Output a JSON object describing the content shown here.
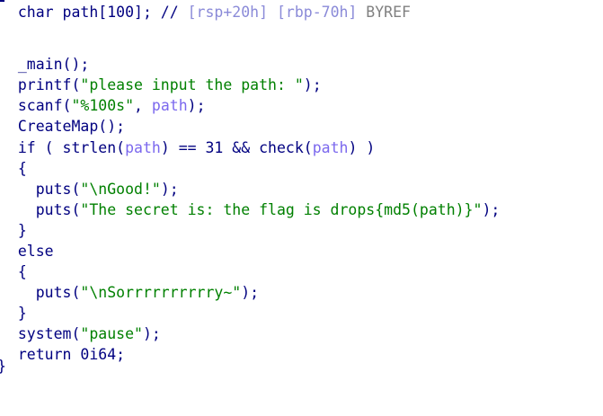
{
  "colors": {
    "default": "#000080",
    "string": "#008000",
    "variable": "#7b68ee",
    "comment": "#808080",
    "ref": "#8a8ad8",
    "background": "#ffffff"
  },
  "code_lines": [
    {
      "kind": "declaration",
      "tokens": [
        {
          "t": "  char path[100]; // ",
          "c": "default"
        },
        {
          "t": "[rsp+20h] [rbp-70h]",
          "c": "ref"
        },
        {
          "t": " BYREF",
          "c": "comment"
        }
      ]
    },
    {
      "kind": "blank",
      "tokens": []
    },
    {
      "kind": "call",
      "tokens": [
        {
          "t": "  _main();",
          "c": "default"
        }
      ]
    },
    {
      "kind": "call",
      "tokens": [
        {
          "t": "  printf(",
          "c": "default"
        },
        {
          "t": "\"please input the path: \"",
          "c": "string"
        },
        {
          "t": ");",
          "c": "default"
        }
      ]
    },
    {
      "kind": "call",
      "tokens": [
        {
          "t": "  scanf(",
          "c": "default"
        },
        {
          "t": "\"%100s\"",
          "c": "string"
        },
        {
          "t": ", ",
          "c": "default"
        },
        {
          "t": "path",
          "c": "variable"
        },
        {
          "t": ");",
          "c": "default"
        }
      ]
    },
    {
      "kind": "call",
      "tokens": [
        {
          "t": "  CreateMap();",
          "c": "default"
        }
      ]
    },
    {
      "kind": "condition",
      "tokens": [
        {
          "t": "  if ( strlen(",
          "c": "default"
        },
        {
          "t": "path",
          "c": "variable"
        },
        {
          "t": ") == 31 && check(",
          "c": "default"
        },
        {
          "t": "path",
          "c": "variable"
        },
        {
          "t": ") )",
          "c": "default"
        }
      ]
    },
    {
      "kind": "brace",
      "tokens": [
        {
          "t": "  {",
          "c": "default"
        }
      ]
    },
    {
      "kind": "call",
      "tokens": [
        {
          "t": "    puts(",
          "c": "default"
        },
        {
          "t": "\"\\nGood!\"",
          "c": "string"
        },
        {
          "t": ");",
          "c": "default"
        }
      ]
    },
    {
      "kind": "call",
      "tokens": [
        {
          "t": "    puts(",
          "c": "default"
        },
        {
          "t": "\"The secret is: the flag is drops{md5(path)}\"",
          "c": "string"
        },
        {
          "t": ");",
          "c": "default"
        }
      ]
    },
    {
      "kind": "brace",
      "tokens": [
        {
          "t": "  }",
          "c": "default"
        }
      ]
    },
    {
      "kind": "keyword",
      "tokens": [
        {
          "t": "  else",
          "c": "default"
        }
      ]
    },
    {
      "kind": "brace",
      "tokens": [
        {
          "t": "  {",
          "c": "default"
        }
      ]
    },
    {
      "kind": "call",
      "tokens": [
        {
          "t": "    puts(",
          "c": "default"
        },
        {
          "t": "\"\\nSorrrrrrrrrry~\"",
          "c": "string"
        },
        {
          "t": ");",
          "c": "default"
        }
      ]
    },
    {
      "kind": "brace",
      "tokens": [
        {
          "t": "  }",
          "c": "default"
        }
      ]
    },
    {
      "kind": "call",
      "tokens": [
        {
          "t": "  system(",
          "c": "default"
        },
        {
          "t": "\"pause\"",
          "c": "string"
        },
        {
          "t": ");",
          "c": "default"
        }
      ]
    },
    {
      "kind": "return",
      "tokens": [
        {
          "t": "  return 0i64;",
          "c": "default"
        }
      ]
    },
    {
      "kind": "brace",
      "tokens": [
        {
          "t": "}",
          "c": "default"
        }
      ]
    }
  ]
}
